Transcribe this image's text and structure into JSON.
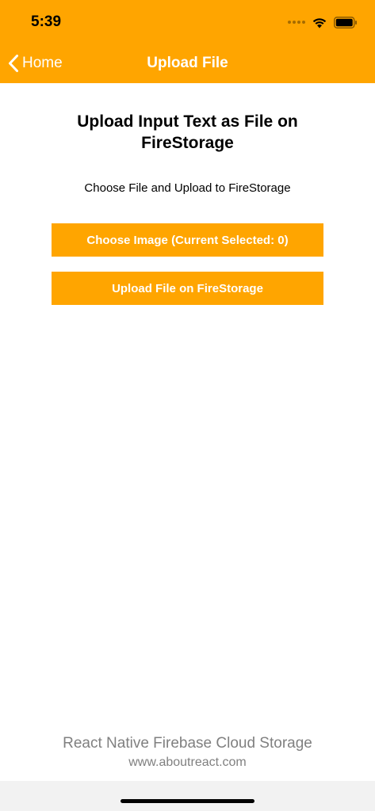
{
  "status_bar": {
    "time": "5:39"
  },
  "nav": {
    "back_label": "Home",
    "title": "Upload File"
  },
  "content": {
    "heading": "Upload Input Text as File on FireStorage",
    "subtitle": "Choose File and Upload to FireStorage",
    "choose_button_label": "Choose Image (Current Selected: 0)",
    "upload_button_label": "Upload File on FireStorage"
  },
  "footer": {
    "line1": "React Native Firebase Cloud Storage",
    "line2": "www.aboutreact.com"
  },
  "colors": {
    "accent": "#ffa500",
    "footer_text": "#808080",
    "background": "#ffffff"
  },
  "icons": {
    "back": "chevron-left-icon",
    "signal": "cellular-signal-icon",
    "wifi": "wifi-icon",
    "battery": "battery-icon"
  }
}
